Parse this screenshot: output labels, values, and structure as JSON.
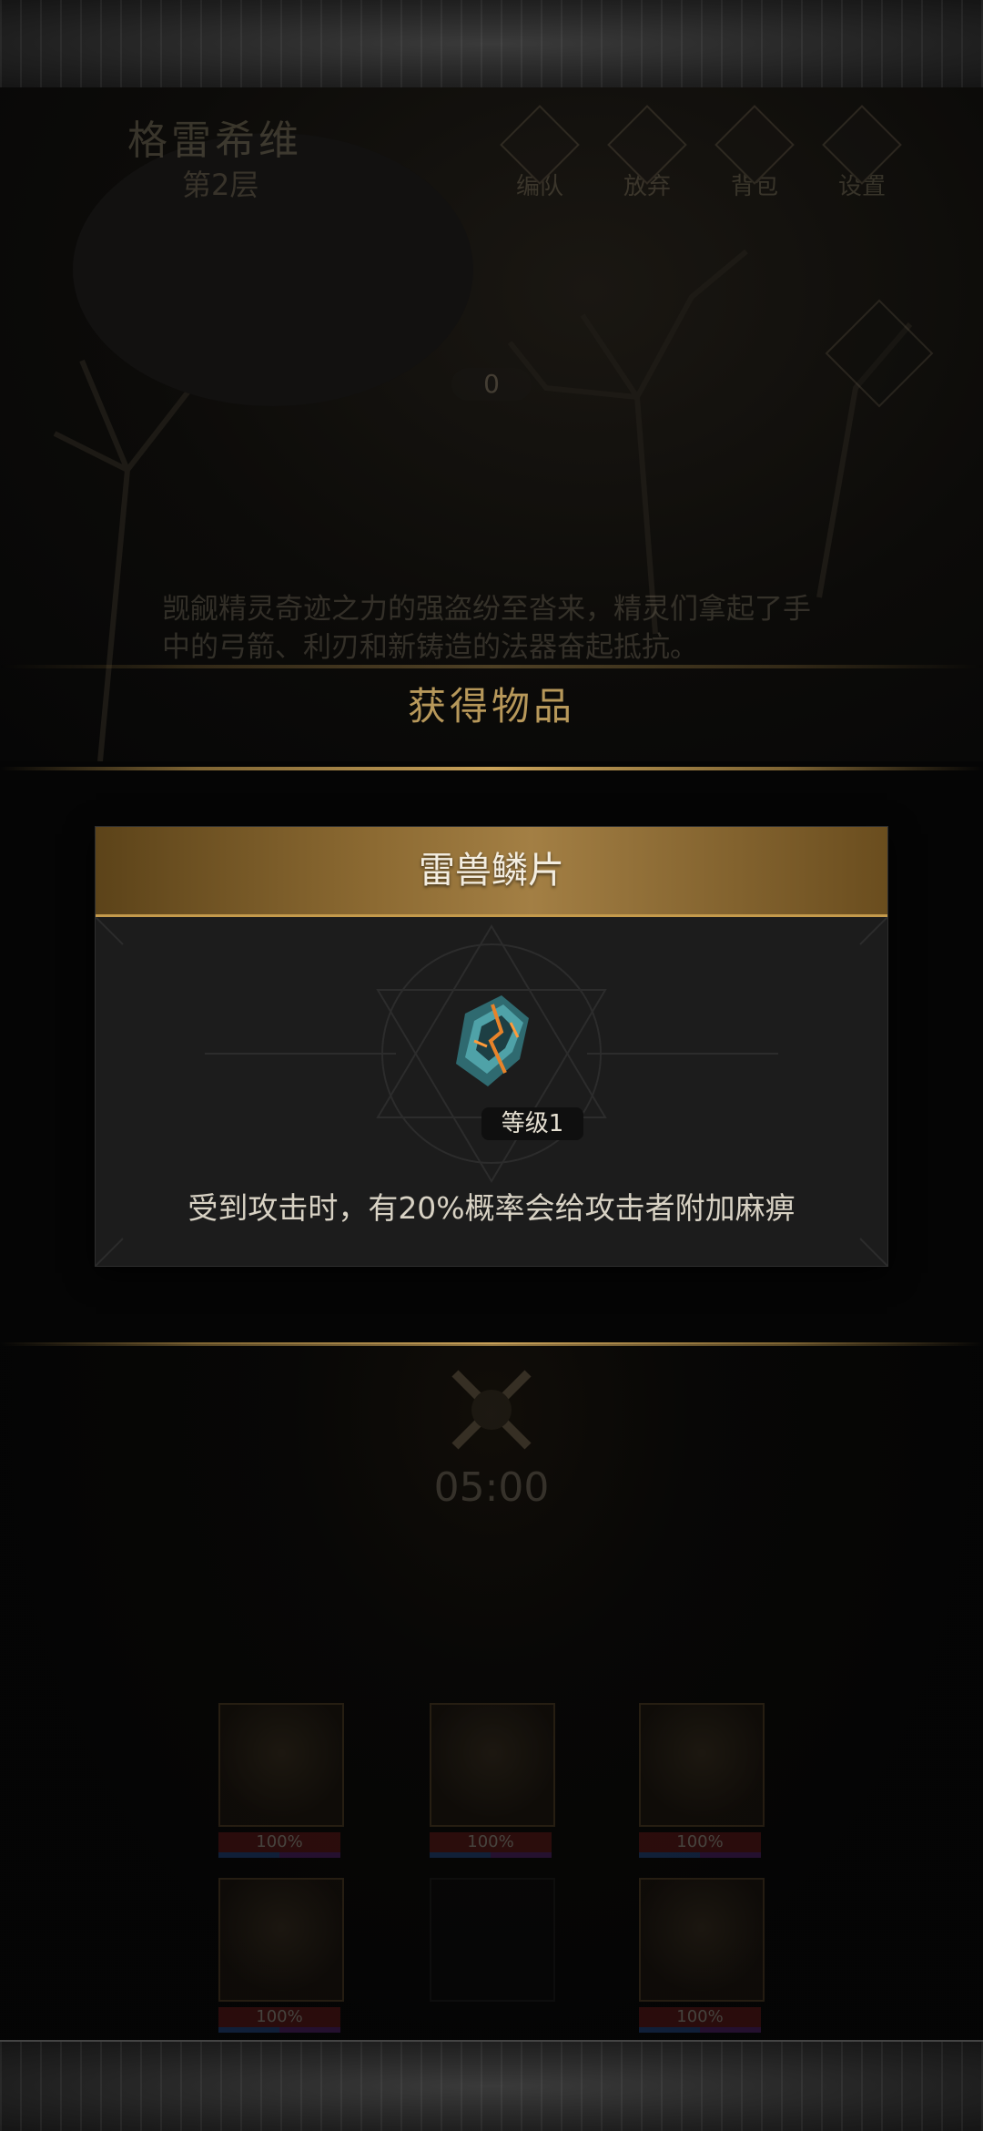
{
  "header": {
    "floor_name": "格雷希维",
    "floor_level": "第2层",
    "buttons": [
      {
        "label": "编队",
        "icon": "team-icon"
      },
      {
        "label": "放弃",
        "icon": "flag-icon"
      },
      {
        "label": "背包",
        "icon": "bag-icon"
      },
      {
        "label": "设置",
        "icon": "gear-icon"
      }
    ]
  },
  "score": "0",
  "story_text": "觊觎精灵奇迹之力的强盗纷至沓来，精灵们拿起了手中的弓箭、利刃和新铸造的法器奋起抵抗。",
  "obtain_title": "获得物品",
  "item": {
    "name": "雷兽鳞片",
    "level": "等级1",
    "description": "受到攻击时，有20%概率会给攻击者附加麻痹",
    "header_color": "#8c6a32"
  },
  "timer": "05:00",
  "heroes": [
    {
      "hp": "100%",
      "present": true
    },
    {
      "hp": "100%",
      "present": true
    },
    {
      "hp": "100%",
      "present": true
    },
    {
      "hp": "100%",
      "present": true
    },
    {
      "hp": "",
      "present": false
    },
    {
      "hp": "100%",
      "present": true
    }
  ],
  "colors": {
    "accent_gold": "#c9a25a",
    "hp_red": "#7a1f1f",
    "mp_blue": "#2a5aa8"
  }
}
